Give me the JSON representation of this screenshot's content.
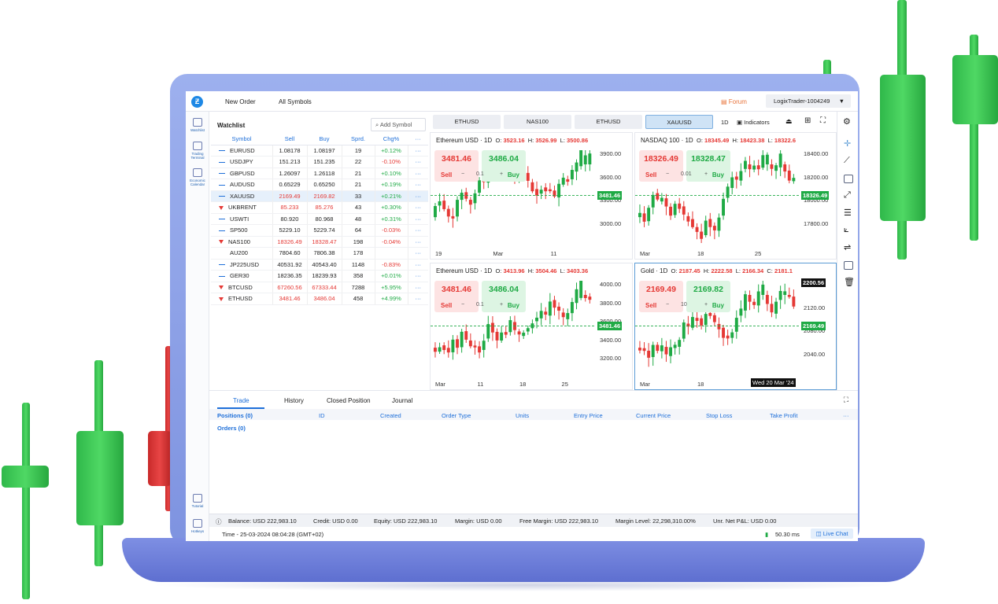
{
  "topbar": {
    "new_order": "New Order",
    "all_symbols": "All Symbols",
    "forum": "Forum",
    "account": "LogixTrader-1004249"
  },
  "leftnav": {
    "watchlist": "Watchlist",
    "trading_terminal": "Trading Terminal",
    "economic_calendar": "Economic Calendar",
    "tutorial": "Tutorial",
    "hotkeys": "Hotkeys"
  },
  "watchlist": {
    "title": "Watchlist",
    "add_symbol": "Add Symbol",
    "more": "···",
    "headers": [
      "Symbol",
      "Sell",
      "Buy",
      "Sprd.",
      "Chg%"
    ],
    "rows": [
      {
        "symbol": "EURUSD",
        "sell": "1.08178",
        "buy": "1.08197",
        "spread": "19",
        "chg": "+0.12%",
        "dir": "flat",
        "chg_pos": true
      },
      {
        "symbol": "USDJPY",
        "sell": "151.213",
        "buy": "151.235",
        "spread": "22",
        "chg": "-0.10%",
        "dir": "flat",
        "chg_pos": false
      },
      {
        "symbol": "GBPUSD",
        "sell": "1.26097",
        "buy": "1.26118",
        "spread": "21",
        "chg": "+0.10%",
        "dir": "flat",
        "chg_pos": true
      },
      {
        "symbol": "AUDUSD",
        "sell": "0.65229",
        "buy": "0.65250",
        "spread": "21",
        "chg": "+0.19%",
        "dir": "flat",
        "chg_pos": true
      },
      {
        "symbol": "XAUUSD",
        "sell": "2169.49",
        "buy": "2169.82",
        "spread": "33",
        "chg": "+0.21%",
        "dir": "flat",
        "chg_pos": true,
        "red": true,
        "selected": true
      },
      {
        "symbol": "UKBRENT",
        "sell": "85.233",
        "buy": "85.276",
        "spread": "43",
        "chg": "+0.30%",
        "dir": "down",
        "chg_pos": true,
        "red": true
      },
      {
        "symbol": "USWTI",
        "sell": "80.920",
        "buy": "80.968",
        "spread": "48",
        "chg": "+0.31%",
        "dir": "flat",
        "chg_pos": true
      },
      {
        "symbol": "SP500",
        "sell": "5229.10",
        "buy": "5229.74",
        "spread": "64",
        "chg": "-0.03%",
        "dir": "flat",
        "chg_pos": false
      },
      {
        "symbol": "NAS100",
        "sell": "18326.49",
        "buy": "18328.47",
        "spread": "198",
        "chg": "-0.04%",
        "dir": "down",
        "chg_pos": false,
        "red": true
      },
      {
        "symbol": "AU200",
        "sell": "7804.60",
        "buy": "7806.38",
        "spread": "178",
        "chg": "",
        "dir": "none",
        "chg_pos": true
      },
      {
        "symbol": "JP225USD",
        "sell": "40531.92",
        "buy": "40543.40",
        "spread": "1148",
        "chg": "-0.83%",
        "dir": "flat",
        "chg_pos": false
      },
      {
        "symbol": "GER30",
        "sell": "18236.35",
        "buy": "18239.93",
        "spread": "358",
        "chg": "+0.01%",
        "dir": "flat",
        "chg_pos": true
      },
      {
        "symbol": "BTCUSD",
        "sell": "67260.56",
        "buy": "67333.44",
        "spread": "7288",
        "chg": "+5.95%",
        "dir": "down",
        "chg_pos": true,
        "red": true
      },
      {
        "symbol": "ETHUSD",
        "sell": "3481.46",
        "buy": "3486.04",
        "spread": "458",
        "chg": "+4.99%",
        "dir": "down",
        "chg_pos": true,
        "red": true
      }
    ]
  },
  "chart_tabs": [
    "ETHUSD",
    "NAS100",
    "ETHUSD",
    "XAUUSD"
  ],
  "chart_toolbar": {
    "interval": "1D",
    "indicators": "Indicators"
  },
  "charts": [
    {
      "title": "Ethereum USD · 1D",
      "o": "3523.16",
      "h": "3526.99",
      "l": "3500.86",
      "sell": "3481.46",
      "buy": "3486.04",
      "qty": "0.1",
      "yticks": [
        "3900.00",
        "3600.00",
        "3300.00",
        "3000.00"
      ],
      "xticks": [
        "19",
        "Mar",
        "11"
      ],
      "price_label": "3481.46"
    },
    {
      "title": "NASDAQ 100 · 1D",
      "o": "18345.49",
      "h": "18423.38",
      "l": "18322.6",
      "sell": "18326.49",
      "buy": "18328.47",
      "qty": "0.01",
      "yticks": [
        "18400.00",
        "18200.00",
        "18000.00",
        "17800.00"
      ],
      "xticks": [
        "Mar",
        "18",
        "25"
      ],
      "price_label": "18326.49"
    },
    {
      "title": "Ethereum USD · 1D",
      "o": "3413.96",
      "h": "3504.46",
      "l": "3403.36",
      "sell": "3481.46",
      "buy": "3486.04",
      "qty": "0.1",
      "yticks": [
        "4000.00",
        "3800.00",
        "3600.00",
        "3400.00",
        "3200.00"
      ],
      "xticks": [
        "Mar",
        "11",
        "18",
        "25"
      ],
      "price_label": "3481.46"
    },
    {
      "title": "Gold · 1D",
      "o": "2187.45",
      "h": "2222.58",
      "l": "2166.34",
      "c": "2181.1",
      "sell": "2169.49",
      "buy": "2169.82",
      "qty": "10",
      "yticks": [
        "2160.00",
        "2120.00",
        "2080.00",
        "2040.00"
      ],
      "xticks": [
        "Mar",
        "18",
        "25"
      ],
      "price_label": "2169.49",
      "cross_label": "2200.56",
      "date_label": "Wed 20 Mar '24"
    }
  ],
  "trade": {
    "tabs": [
      "Trade",
      "History",
      "Closed Position",
      "Journal"
    ],
    "positions": "Positions (0)",
    "orders": "Orders (0)",
    "columns": [
      "ID",
      "Created",
      "Order Type",
      "Units",
      "Entry Price",
      "Current Price",
      "Stop Loss",
      "Take Profit"
    ]
  },
  "status": {
    "balance": "Balance: USD 222,983.10",
    "credit": "Credit: USD 0.00",
    "equity": "Equity: USD 222,983.10",
    "margin": "Margin: USD 0.00",
    "free_margin": "Free Margin: USD 222,983.10",
    "margin_level": "Margin Level: 22,298,310.00%",
    "unr": "Unr. Net P&L: USD 0.00",
    "time": "Time - 25-03-2024 08:04:28 (GMT+02)",
    "latency": "50.30 ms",
    "live_chat": "Live Chat"
  },
  "colors": {
    "green": "#1faa45",
    "red": "#e53935",
    "blue": "#1e6fd9",
    "frame": "#8b9ee6"
  }
}
